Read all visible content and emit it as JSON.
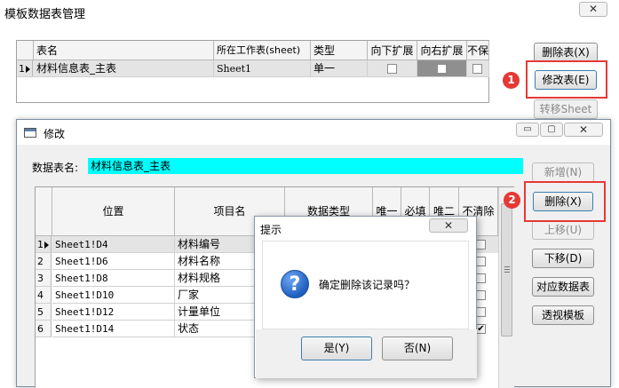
{
  "main_window": {
    "title": "模板数据表管理",
    "close_glyph": "✕",
    "table": {
      "headers": [
        "表名",
        "所在工作表(sheet)",
        "类型",
        "向下扩展",
        "向右扩展",
        "不保存"
      ],
      "rows": [
        {
          "num": "1",
          "name": "材料信息表_主表",
          "sheet": "Sheet1",
          "type": "单一"
        }
      ]
    },
    "buttons": {
      "delete_table": "删除表(X)",
      "modify_table": "修改表(E)",
      "move_sheet": "转移Sheet"
    }
  },
  "edit_window": {
    "title": "修改",
    "name_label": "数据表名:",
    "name_value": "材料信息表_主表",
    "table": {
      "headers": [
        "位置",
        "项目名",
        "数据类型",
        "唯一",
        "必填",
        "唯二",
        "不清除"
      ],
      "rows": [
        {
          "num": "1",
          "pos": "Sheet1!D4",
          "item": "材料编号"
        },
        {
          "num": "2",
          "pos": "Sheet1!D6",
          "item": "材料名称"
        },
        {
          "num": "3",
          "pos": "Sheet1!D8",
          "item": "材料规格"
        },
        {
          "num": "4",
          "pos": "Sheet1!D10",
          "item": "厂家"
        },
        {
          "num": "5",
          "pos": "Sheet1!D12",
          "item": "计量单位"
        },
        {
          "num": "6",
          "pos": "Sheet1!D14",
          "item": "状态"
        }
      ]
    },
    "buttons": {
      "add": "新增(N)",
      "delete": "删除(X)",
      "move_up": "上移(U)",
      "move_down": "下移(D)",
      "map_table": "对应数据表",
      "pivot_template": "透视模板"
    },
    "controls": {
      "minimize": "▭",
      "maximize": "▢",
      "close": "✕"
    }
  },
  "dialog": {
    "title": "提示",
    "message": "确定删除该记录吗？",
    "icon_glyph": "?",
    "yes": "是(Y)",
    "no": "否(N)"
  },
  "annotations": {
    "step1": "1",
    "step2": "2"
  },
  "colors": {
    "name_field_bg": "#00ffff",
    "annotation_red": "#e53935",
    "question_icon": "#1f5fbf"
  }
}
